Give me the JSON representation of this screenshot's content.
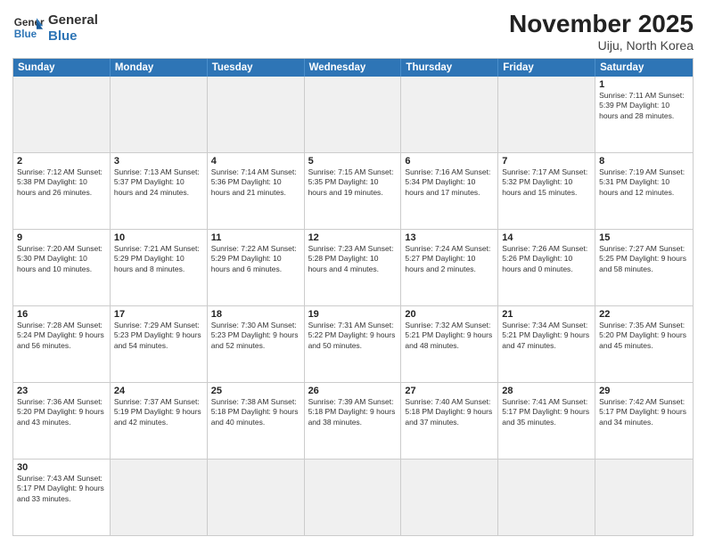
{
  "logo": {
    "line1": "General",
    "line2": "Blue"
  },
  "title": "November 2025",
  "subtitle": "Uiju, North Korea",
  "header_days": [
    "Sunday",
    "Monday",
    "Tuesday",
    "Wednesday",
    "Thursday",
    "Friday",
    "Saturday"
  ],
  "rows": [
    [
      {
        "num": "",
        "info": "",
        "empty": true
      },
      {
        "num": "",
        "info": "",
        "empty": true
      },
      {
        "num": "",
        "info": "",
        "empty": true
      },
      {
        "num": "",
        "info": "",
        "empty": true
      },
      {
        "num": "",
        "info": "",
        "empty": true
      },
      {
        "num": "",
        "info": "",
        "empty": true
      },
      {
        "num": "1",
        "info": "Sunrise: 7:11 AM\nSunset: 5:39 PM\nDaylight: 10 hours\nand 28 minutes.",
        "empty": false
      }
    ],
    [
      {
        "num": "2",
        "info": "Sunrise: 7:12 AM\nSunset: 5:38 PM\nDaylight: 10 hours\nand 26 minutes.",
        "empty": false
      },
      {
        "num": "3",
        "info": "Sunrise: 7:13 AM\nSunset: 5:37 PM\nDaylight: 10 hours\nand 24 minutes.",
        "empty": false
      },
      {
        "num": "4",
        "info": "Sunrise: 7:14 AM\nSunset: 5:36 PM\nDaylight: 10 hours\nand 21 minutes.",
        "empty": false
      },
      {
        "num": "5",
        "info": "Sunrise: 7:15 AM\nSunset: 5:35 PM\nDaylight: 10 hours\nand 19 minutes.",
        "empty": false
      },
      {
        "num": "6",
        "info": "Sunrise: 7:16 AM\nSunset: 5:34 PM\nDaylight: 10 hours\nand 17 minutes.",
        "empty": false
      },
      {
        "num": "7",
        "info": "Sunrise: 7:17 AM\nSunset: 5:32 PM\nDaylight: 10 hours\nand 15 minutes.",
        "empty": false
      },
      {
        "num": "8",
        "info": "Sunrise: 7:19 AM\nSunset: 5:31 PM\nDaylight: 10 hours\nand 12 minutes.",
        "empty": false
      }
    ],
    [
      {
        "num": "9",
        "info": "Sunrise: 7:20 AM\nSunset: 5:30 PM\nDaylight: 10 hours\nand 10 minutes.",
        "empty": false
      },
      {
        "num": "10",
        "info": "Sunrise: 7:21 AM\nSunset: 5:29 PM\nDaylight: 10 hours\nand 8 minutes.",
        "empty": false
      },
      {
        "num": "11",
        "info": "Sunrise: 7:22 AM\nSunset: 5:29 PM\nDaylight: 10 hours\nand 6 minutes.",
        "empty": false
      },
      {
        "num": "12",
        "info": "Sunrise: 7:23 AM\nSunset: 5:28 PM\nDaylight: 10 hours\nand 4 minutes.",
        "empty": false
      },
      {
        "num": "13",
        "info": "Sunrise: 7:24 AM\nSunset: 5:27 PM\nDaylight: 10 hours\nand 2 minutes.",
        "empty": false
      },
      {
        "num": "14",
        "info": "Sunrise: 7:26 AM\nSunset: 5:26 PM\nDaylight: 10 hours\nand 0 minutes.",
        "empty": false
      },
      {
        "num": "15",
        "info": "Sunrise: 7:27 AM\nSunset: 5:25 PM\nDaylight: 9 hours\nand 58 minutes.",
        "empty": false
      }
    ],
    [
      {
        "num": "16",
        "info": "Sunrise: 7:28 AM\nSunset: 5:24 PM\nDaylight: 9 hours\nand 56 minutes.",
        "empty": false
      },
      {
        "num": "17",
        "info": "Sunrise: 7:29 AM\nSunset: 5:23 PM\nDaylight: 9 hours\nand 54 minutes.",
        "empty": false
      },
      {
        "num": "18",
        "info": "Sunrise: 7:30 AM\nSunset: 5:23 PM\nDaylight: 9 hours\nand 52 minutes.",
        "empty": false
      },
      {
        "num": "19",
        "info": "Sunrise: 7:31 AM\nSunset: 5:22 PM\nDaylight: 9 hours\nand 50 minutes.",
        "empty": false
      },
      {
        "num": "20",
        "info": "Sunrise: 7:32 AM\nSunset: 5:21 PM\nDaylight: 9 hours\nand 48 minutes.",
        "empty": false
      },
      {
        "num": "21",
        "info": "Sunrise: 7:34 AM\nSunset: 5:21 PM\nDaylight: 9 hours\nand 47 minutes.",
        "empty": false
      },
      {
        "num": "22",
        "info": "Sunrise: 7:35 AM\nSunset: 5:20 PM\nDaylight: 9 hours\nand 45 minutes.",
        "empty": false
      }
    ],
    [
      {
        "num": "23",
        "info": "Sunrise: 7:36 AM\nSunset: 5:20 PM\nDaylight: 9 hours\nand 43 minutes.",
        "empty": false
      },
      {
        "num": "24",
        "info": "Sunrise: 7:37 AM\nSunset: 5:19 PM\nDaylight: 9 hours\nand 42 minutes.",
        "empty": false
      },
      {
        "num": "25",
        "info": "Sunrise: 7:38 AM\nSunset: 5:18 PM\nDaylight: 9 hours\nand 40 minutes.",
        "empty": false
      },
      {
        "num": "26",
        "info": "Sunrise: 7:39 AM\nSunset: 5:18 PM\nDaylight: 9 hours\nand 38 minutes.",
        "empty": false
      },
      {
        "num": "27",
        "info": "Sunrise: 7:40 AM\nSunset: 5:18 PM\nDaylight: 9 hours\nand 37 minutes.",
        "empty": false
      },
      {
        "num": "28",
        "info": "Sunrise: 7:41 AM\nSunset: 5:17 PM\nDaylight: 9 hours\nand 35 minutes.",
        "empty": false
      },
      {
        "num": "29",
        "info": "Sunrise: 7:42 AM\nSunset: 5:17 PM\nDaylight: 9 hours\nand 34 minutes.",
        "empty": false
      }
    ],
    [
      {
        "num": "30",
        "info": "Sunrise: 7:43 AM\nSunset: 5:17 PM\nDaylight: 9 hours\nand 33 minutes.",
        "empty": false
      },
      {
        "num": "",
        "info": "",
        "empty": true
      },
      {
        "num": "",
        "info": "",
        "empty": true
      },
      {
        "num": "",
        "info": "",
        "empty": true
      },
      {
        "num": "",
        "info": "",
        "empty": true
      },
      {
        "num": "",
        "info": "",
        "empty": true
      },
      {
        "num": "",
        "info": "",
        "empty": true
      }
    ]
  ]
}
